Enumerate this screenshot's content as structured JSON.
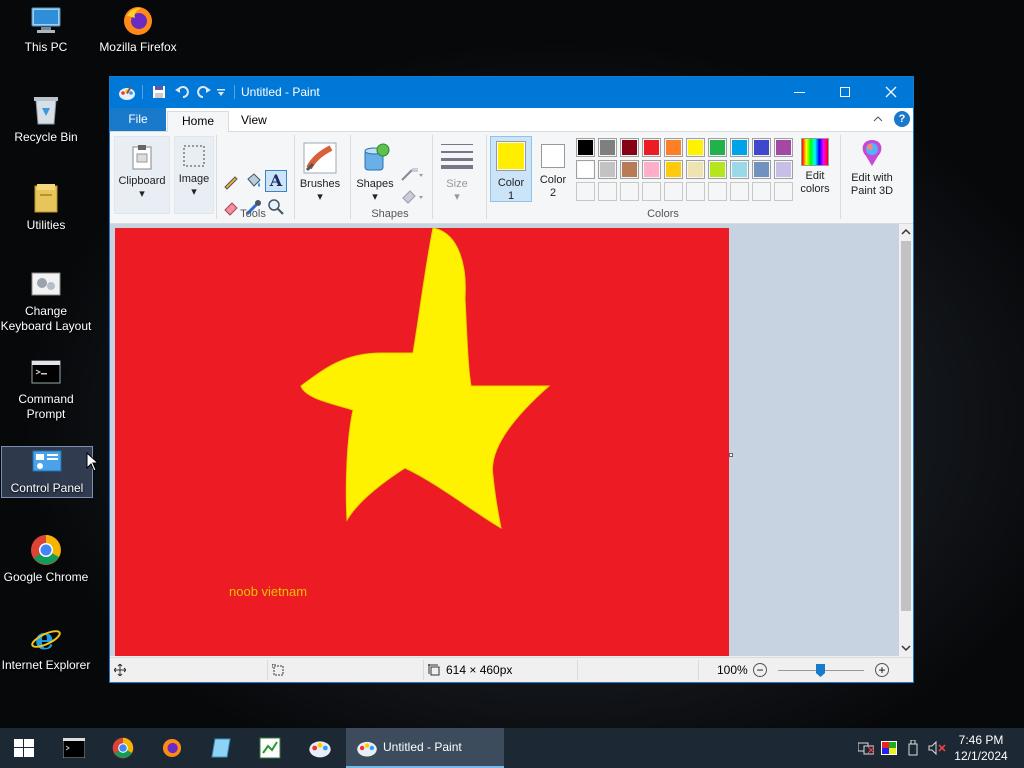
{
  "desktop": {
    "icons": [
      {
        "label": "This PC"
      },
      {
        "label": "Mozilla Firefox"
      },
      {
        "label": "Recycle Bin"
      },
      {
        "label": "Utilities"
      },
      {
        "label": "Change Keyboard Layout"
      },
      {
        "label": "Command Prompt"
      },
      {
        "label": "Control Panel"
      },
      {
        "label": "Google Chrome"
      },
      {
        "label": "Internet Explorer"
      }
    ]
  },
  "window": {
    "title": "Untitled - Paint"
  },
  "tabs": {
    "file": "File",
    "home": "Home",
    "view": "View"
  },
  "ribbon": {
    "clipboard": "Clipboard",
    "image": "Image",
    "tools": "Tools",
    "brushes": "Brushes",
    "shapes": "Shapes",
    "shapes_group": "Shapes",
    "size": "Size",
    "color1_a": "Color",
    "color1_b": "1",
    "color2_a": "Color",
    "color2_b": "2",
    "edit_colors_a": "Edit",
    "edit_colors_b": "colors",
    "paint3d_a": "Edit with",
    "paint3d_b": "Paint 3D",
    "colors_group": "Colors",
    "color1_value": "#ffee00",
    "color2_value": "#ffffff",
    "palette_row1": [
      "#000000",
      "#7f7f7f",
      "#880015",
      "#ed1c24",
      "#ff7f27",
      "#fff200",
      "#22b14c",
      "#00a2e8",
      "#3f48cc",
      "#a349a4"
    ],
    "palette_row2": [
      "#ffffff",
      "#c3c3c3",
      "#b97a57",
      "#ffaec9",
      "#ffc90e",
      "#efe4b0",
      "#b5e61d",
      "#99d9ea",
      "#7092be",
      "#c8bfe7"
    ]
  },
  "canvas": {
    "text": "noob vietnam",
    "background": "#ed1c24",
    "star_color": "#fff200"
  },
  "status": {
    "dimensions": "614 × 460px",
    "zoom": "100%"
  },
  "taskbar": {
    "active_label": "Untitled - Paint",
    "time": "7:46 PM",
    "date": "12/1/2024"
  }
}
